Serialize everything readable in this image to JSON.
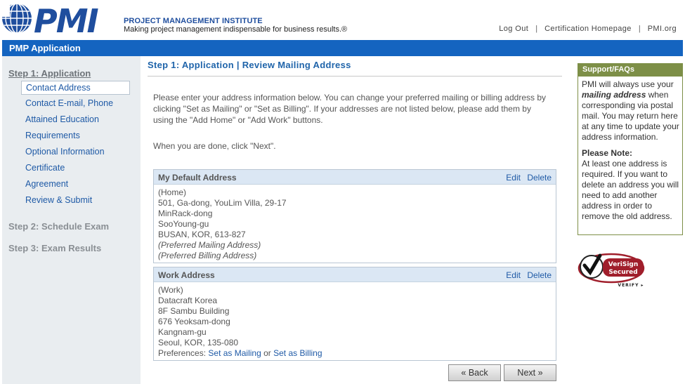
{
  "header": {
    "logo_text": "PMI",
    "org_name": "PROJECT MANAGEMENT INSTITUTE",
    "tagline": "Making project management indispensable for business results.®",
    "links": [
      {
        "label": "Log Out"
      },
      {
        "label": "Certification Homepage"
      },
      {
        "label": "PMI.org"
      }
    ],
    "separator": "|"
  },
  "app_bar": {
    "title": "PMP Application"
  },
  "leftnav": {
    "step1": "Step 1: Application",
    "items": [
      {
        "label": "Contact Address",
        "active": true
      },
      {
        "label": "Contact E-mail, Phone"
      },
      {
        "label": "Attained Education"
      },
      {
        "label": "Requirements"
      },
      {
        "label": "Optional Information"
      },
      {
        "label": "Certificate"
      },
      {
        "label": "Agreement"
      },
      {
        "label": "Review & Submit"
      }
    ],
    "step2": "Step 2: Schedule Exam",
    "step3": "Step 3: Exam Results"
  },
  "main": {
    "title": "Step 1: Application | Review Mailing Address",
    "intro": "Please enter your address information below. You can change your preferred mailing or billing address by clicking \"Set as Mailing\" or \"Set as Billing\". If your addresses are not listed below, please add them by using the \"Add Home\" or \"Add Work\" buttons.",
    "done_text": "When you are done, click \"Next\".",
    "edit_label": "Edit",
    "delete_label": "Delete",
    "default_address": {
      "title": "My Default Address",
      "lines": [
        "(Home)",
        "501, Ga-dong, YouLim Villa, 29-17",
        "MinRack-dong",
        "SooYoung-gu",
        "BUSAN, KOR, 613-827"
      ],
      "pref_mailing": "(Preferred Mailing Address)",
      "pref_billing": "(Preferred Billing Address)"
    },
    "work_address": {
      "title": "Work Address",
      "lines": [
        "(Work)",
        "Datacraft Korea",
        "8F Sambu Building",
        "676 Yeoksam-dong",
        "Kangnam-gu",
        "Seoul, KOR, 135-080"
      ],
      "pref_label": "Preferences:",
      "set_mailing": "Set as Mailing",
      "or": "or",
      "set_billing": "Set as Billing"
    },
    "back_label": "« Back",
    "next_label": "Next »"
  },
  "support": {
    "title": "Support/FAQs",
    "text_pre": "PMI will always use your",
    "text_em": "mailing address",
    "text_post": "when corresponding via postal mail. You may return here at any time to update your address information.",
    "note_title": "Please Note:",
    "note_text": "At least one address is required. If you want to delete an address you will need to add another address in order to remove the old address."
  },
  "verisign": {
    "line1": "VeriSign",
    "line2": "Secured",
    "line3": "VERIFY ▸"
  },
  "colors": {
    "brand_blue": "#1464c0",
    "support_green": "#7d8f47",
    "link_blue": "#1f5aa6"
  }
}
